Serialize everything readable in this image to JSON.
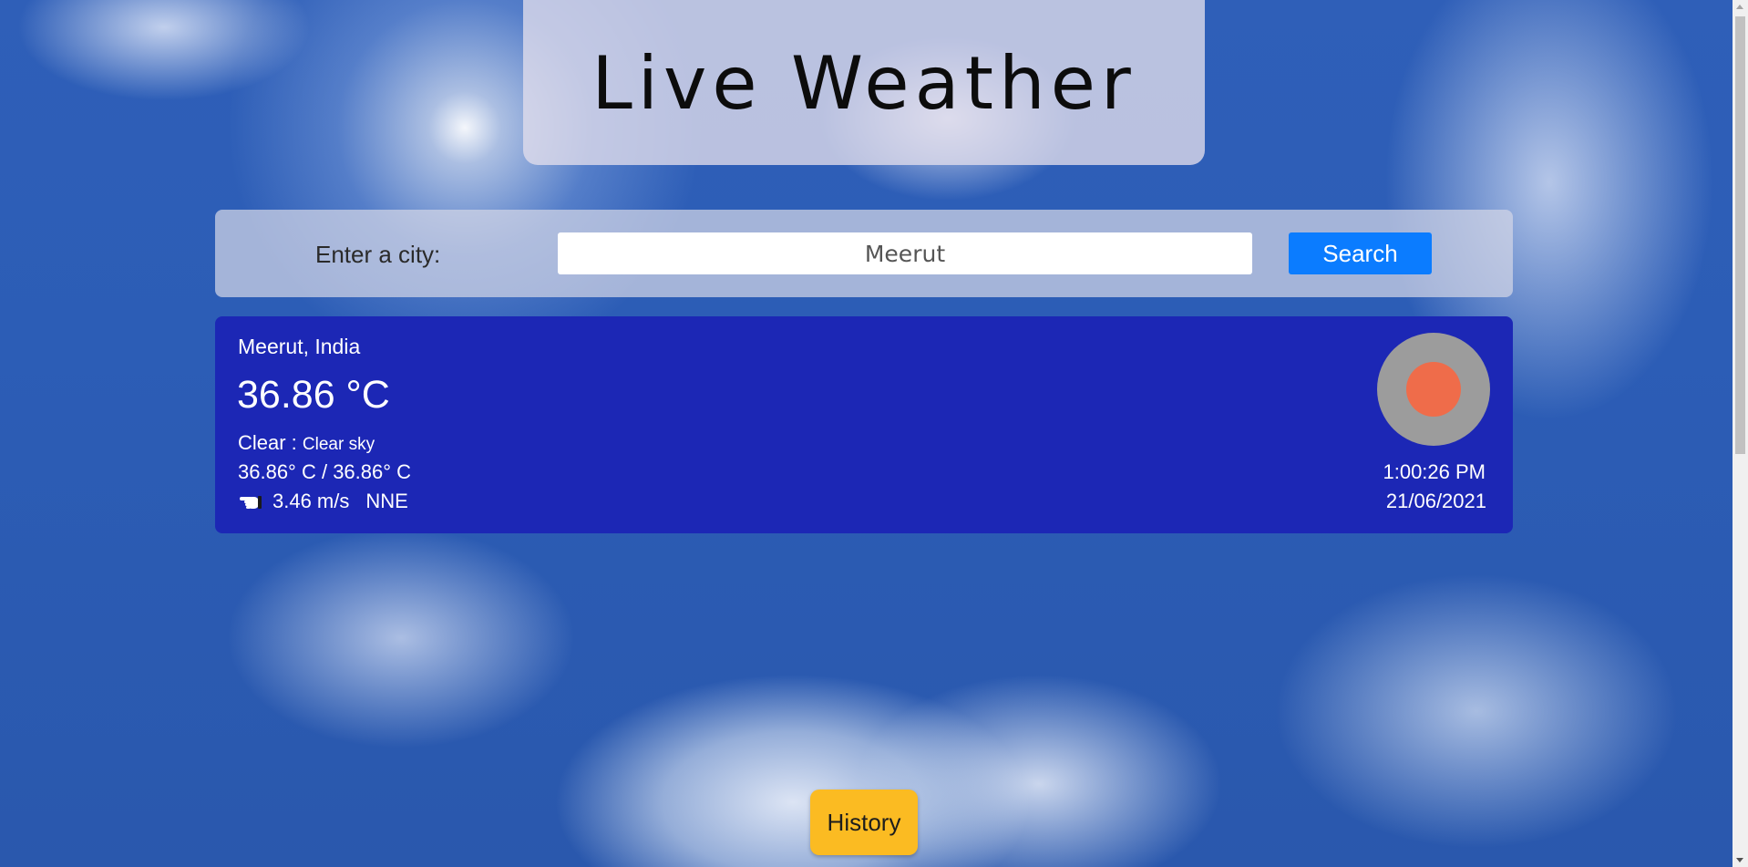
{
  "header": {
    "title": "Live Weather"
  },
  "search": {
    "label": "Enter a city:",
    "value": "Meerut",
    "button_label": "Search"
  },
  "weather": {
    "location": "Meerut, India",
    "temperature": "36.86 °C",
    "condition_main": "Clear : ",
    "condition_desc": "Clear sky",
    "min_max": "36.86° C /  36.86° C",
    "wind_icon": "pointing-hand-icon",
    "wind_speed": "3.46 m/s",
    "wind_direction": "NNE",
    "weather_icon": "clear-sky-sun-icon",
    "time": "1:00:26 PM",
    "date": "21/06/2021"
  },
  "footer": {
    "history_label": "History"
  },
  "colors": {
    "card_bg": "#1c27b5",
    "search_button": "#0b7cff",
    "history_button": "#fbbb22",
    "sun": "#ef6c4a"
  }
}
